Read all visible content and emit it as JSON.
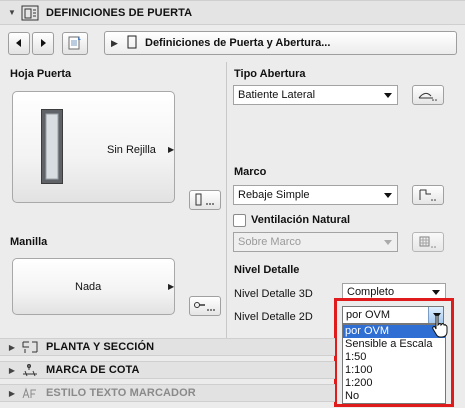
{
  "top_section": {
    "title": "DEFINICIONES DE PUERTA"
  },
  "nav": {
    "path_label": "Definiciones de Puerta y Abertura..."
  },
  "hoja_puerta": {
    "label": "Hoja Puerta",
    "value": "Sin Rejilla"
  },
  "manilla": {
    "label": "Manilla",
    "value": "Nada"
  },
  "tipo_abertura": {
    "label": "Tipo Abertura",
    "value": "Batiente Lateral"
  },
  "marco": {
    "label": "Marco",
    "value": "Rebaje Simple"
  },
  "ventilacion": {
    "label": "Ventilación Natural",
    "checked": false,
    "value": "Sobre Marco"
  },
  "nivel_detalle": {
    "label": "Nivel Detalle",
    "label_3d": "Nivel Detalle 3D",
    "value_3d": "Completo",
    "label_2d": "Nivel Detalle 2D",
    "value_2d": "por OVM",
    "options": [
      "por OVM",
      "Sensible a Escala",
      "1:50",
      "1:100",
      "1:200",
      "No"
    ],
    "selected_option": "por OVM"
  },
  "collapsed_sections": [
    {
      "title": "PLANTA Y SECCIÓN"
    },
    {
      "title": "MARCA DE COTA"
    },
    {
      "title": "ESTILO TEXTO MARCADOR"
    }
  ],
  "colors": {
    "highlight": "#e01b1b",
    "selection": "#2f6fd3"
  }
}
